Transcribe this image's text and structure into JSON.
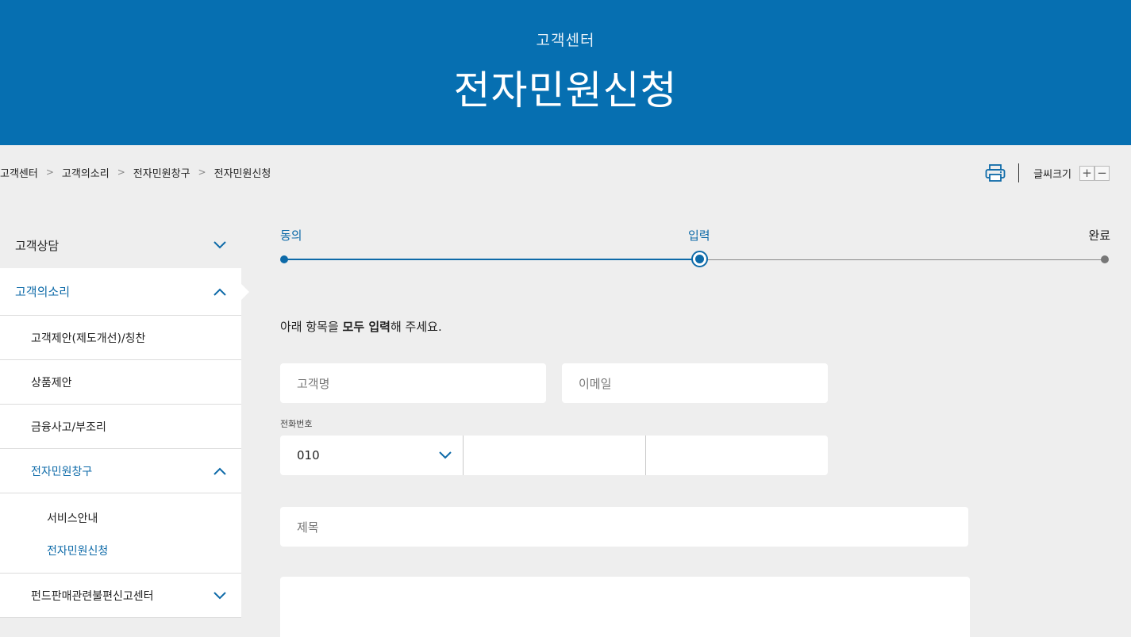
{
  "header": {
    "subtitle": "고객센터",
    "title": "전자민원신청"
  },
  "breadcrumb": [
    "고객센터",
    "고객의소리",
    "전자민원창구",
    "전자민원신청"
  ],
  "tools": {
    "font_size_label": "글씨크기",
    "plus": "+",
    "minus": "−"
  },
  "sidebar": {
    "groups": [
      {
        "label": "고객상담"
      },
      {
        "label": "고객의소리"
      }
    ],
    "items": [
      {
        "label": "고객제안(제도개선)/칭찬"
      },
      {
        "label": "상품제안"
      },
      {
        "label": "금융사고/부조리"
      },
      {
        "label": "전자민원창구"
      }
    ],
    "subitems": [
      {
        "label": "서비스안내"
      },
      {
        "label": "전자민원신청"
      }
    ],
    "last_item": {
      "label": "펀드판매관련불편신고센터"
    }
  },
  "steps": [
    {
      "label": "동의"
    },
    {
      "label": "입력"
    },
    {
      "label": "완료"
    }
  ],
  "form": {
    "instruction_pre": "아래 항목을 ",
    "instruction_bold": "모두 입력",
    "instruction_post": "해 주세요.",
    "customer_name_placeholder": "고객명",
    "email_placeholder": "이메일",
    "phone_label": "전화번호",
    "phone_prefix": "010",
    "subject_placeholder": "제목"
  },
  "colors": {
    "brand": "#066fb1",
    "accent": "#0d6aa8",
    "background": "#eeeeee"
  }
}
